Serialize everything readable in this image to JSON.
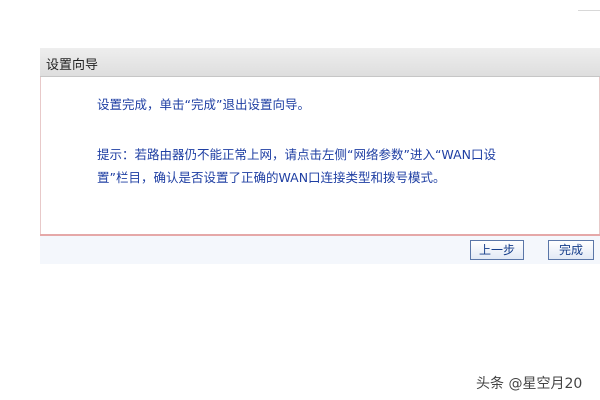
{
  "dialog": {
    "title": "设置向导",
    "message_complete": "设置完成，单击“完成”退出设置向导。",
    "hint_line1": "提示：若路由器仍不能正常上网，请点击左侧“网络参数”进入“WAN口设",
    "hint_line2": "置”栏目，确认是否设置了正确的WAN口连接类型和拨号模式。"
  },
  "buttons": {
    "prev_label": "上一步",
    "finish_label": "完成"
  },
  "watermark": "头条 @星空月20",
  "colors": {
    "text_blue": "#1f3fa3",
    "divider_red": "#e5a8a8",
    "header_gray": "#e6e6e6"
  }
}
